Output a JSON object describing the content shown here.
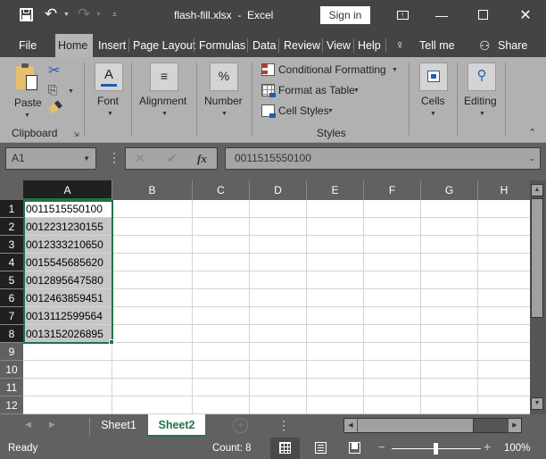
{
  "window": {
    "title": "flash-fill.xlsx  -  Excel",
    "sign_in_label": "Sign in",
    "controls": [
      "ribbon-display-options",
      "minimize",
      "maximize",
      "close"
    ]
  },
  "quick_access": {
    "items": [
      "save-icon",
      "undo-icon",
      "redo-icon",
      "customize-icon"
    ]
  },
  "ribbon_tabs": {
    "items": [
      {
        "label": "File"
      },
      {
        "label": "Home",
        "active": true
      },
      {
        "label": "Insert"
      },
      {
        "label": "Page Layout"
      },
      {
        "label": "Formulas"
      },
      {
        "label": "Data"
      },
      {
        "label": "Review"
      },
      {
        "label": "View"
      },
      {
        "label": "Help"
      }
    ],
    "tell_me": "Tell me",
    "share": "Share"
  },
  "ribbon": {
    "clipboard": {
      "paste": "Paste",
      "group_label": "Clipboard"
    },
    "font": {
      "label": "Font"
    },
    "alignment": {
      "label": "Alignment"
    },
    "number": {
      "label": "Number",
      "glyph": "%"
    },
    "styles": {
      "conditional_formatting": "Conditional Formatting",
      "format_as_table": "Format as Table",
      "cell_styles": "Cell Styles",
      "group_label": "Styles"
    },
    "cells": {
      "label": "Cells"
    },
    "editing": {
      "label": "Editing"
    }
  },
  "formula_bar": {
    "name_box": "A1",
    "fx_label": "fx",
    "formula": "0011515550100"
  },
  "grid": {
    "columns": [
      "A",
      "B",
      "C",
      "D",
      "E",
      "F",
      "G",
      "H"
    ],
    "rows": [
      "1",
      "2",
      "3",
      "4",
      "5",
      "6",
      "7",
      "8",
      "9",
      "10",
      "11",
      "12"
    ],
    "selected_column": "A",
    "column_a": [
      "0011515550100",
      "0012231230155",
      "0012333210650",
      "0015545685620",
      "0012895647580",
      "0012463859451",
      "0013112599564",
      "0013152026895"
    ]
  },
  "sheet_tabs": {
    "items": [
      {
        "label": "Sheet1"
      },
      {
        "label": "Sheet2",
        "active": true
      }
    ]
  },
  "status_bar": {
    "mode": "Ready",
    "count": "Count: 8",
    "zoom": "100%"
  },
  "colors": {
    "accent": "#217346",
    "ribbon_bg": "#b1b1b1",
    "chrome_bg": "#444444",
    "selection_shade": "#c6c6c6"
  }
}
